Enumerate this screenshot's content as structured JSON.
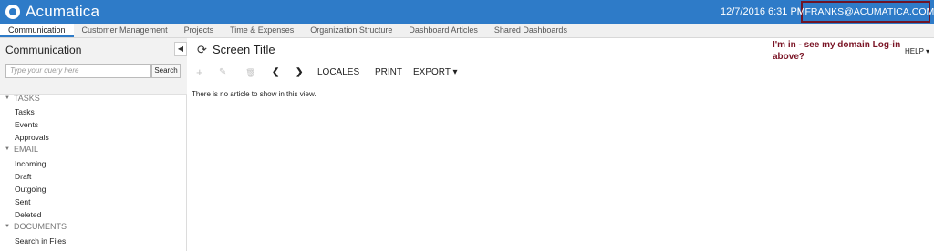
{
  "header": {
    "logo_text": "Acumatica",
    "datetime": "12/7/2016  6:31 PM",
    "user": "MFRANKS@ACUMATICA.COM"
  },
  "tabs": [
    {
      "label": "Communication"
    },
    {
      "label": "Customer Management"
    },
    {
      "label": "Projects"
    },
    {
      "label": "Time & Expenses"
    },
    {
      "label": "Organization Structure"
    },
    {
      "label": "Dashboard Articles"
    },
    {
      "label": "Shared Dashboards"
    }
  ],
  "sidebar": {
    "title": "Communication",
    "collapse_glyph": "◀",
    "search": {
      "placeholder": "Type your query here",
      "button": "Search"
    },
    "groups": [
      {
        "label": "TASKS",
        "items": [
          "Tasks",
          "Events",
          "Approvals"
        ]
      },
      {
        "label": "EMAIL",
        "items": [
          "Incoming",
          "Draft",
          "Outgoing",
          "Sent",
          "Deleted"
        ]
      },
      {
        "label": "DOCUMENTS",
        "items": [
          "Search in Files"
        ]
      }
    ]
  },
  "main": {
    "title": "Screen Title",
    "toolbar": {
      "add": "+",
      "edit": "✎",
      "delete": "🗑",
      "prev": "❮",
      "next": "❯",
      "locales": "LOCALES",
      "print": "PRINT",
      "export": "EXPORT ▾"
    },
    "empty_message": "There is no article to show in this view.",
    "annotation": "I'm in -  see my domain Log-in above?",
    "help": "HELP ▾"
  },
  "colors": {
    "brand": "#2e7bc8",
    "annotation": "#7a1425",
    "highlight_border": "#6e1426"
  }
}
